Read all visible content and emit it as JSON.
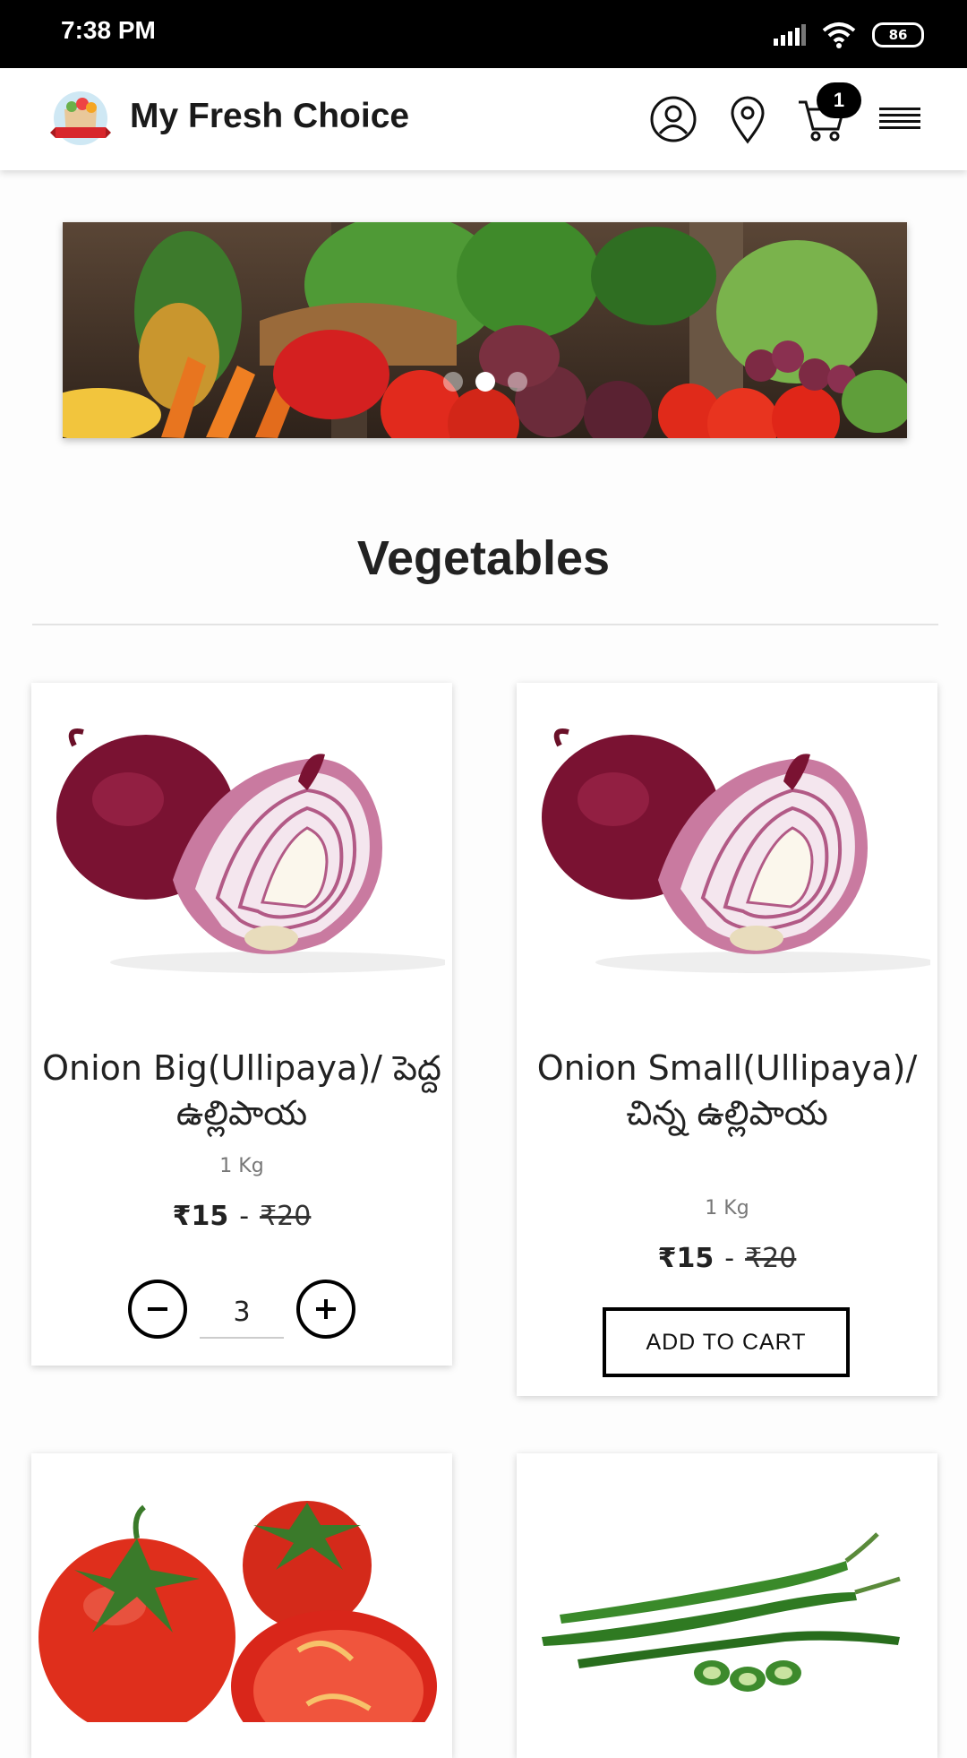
{
  "status_bar": {
    "time": "7:38 PM",
    "battery": "86"
  },
  "header": {
    "title": "My Fresh Choice",
    "cart_count": "1"
  },
  "section": {
    "title": "Vegetables"
  },
  "products": [
    {
      "name": "Onion Big(Ullipaya)/ పెద్ద ఉల్లిపాయ",
      "unit": "1 Kg",
      "price": "₹15",
      "separator": "-",
      "mrp": "₹20",
      "quantity": "3"
    },
    {
      "name": "Onion Small(Ullipaya)/ చిన్న ఉల్లిపాయ",
      "unit": "1 Kg",
      "price": "₹15",
      "separator": "-",
      "mrp": "₹20",
      "button": "ADD TO CART"
    }
  ],
  "icons": {
    "profile": "user-icon",
    "location": "location-pin-icon",
    "cart": "cart-icon",
    "menu": "menu-icon"
  }
}
